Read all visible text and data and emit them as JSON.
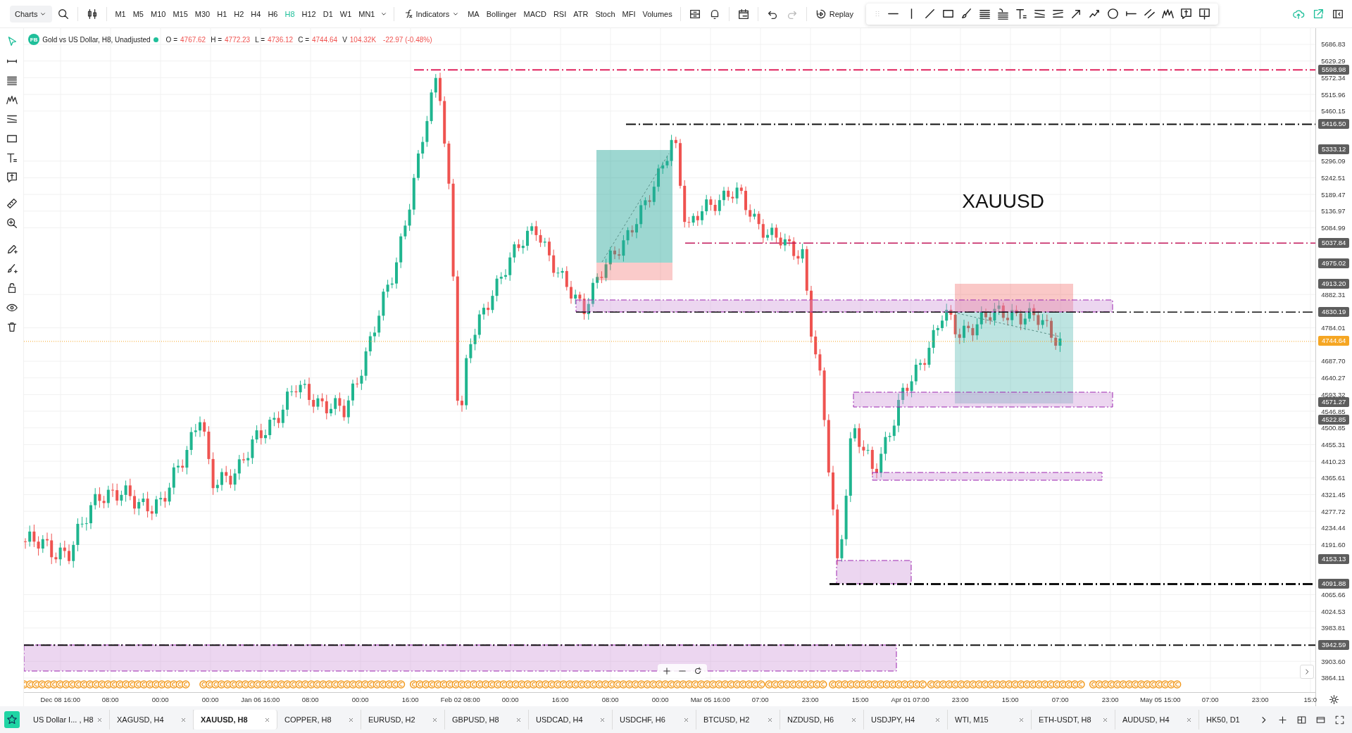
{
  "toolbar": {
    "charts_menu": "Charts",
    "timeframes": [
      {
        "label": "M1",
        "selected": false
      },
      {
        "label": "M5",
        "selected": false
      },
      {
        "label": "M10",
        "selected": false
      },
      {
        "label": "M15",
        "selected": false
      },
      {
        "label": "M30",
        "selected": false
      },
      {
        "label": "H1",
        "selected": false
      },
      {
        "label": "H2",
        "selected": false
      },
      {
        "label": "H4",
        "selected": false
      },
      {
        "label": "H6",
        "selected": false
      },
      {
        "label": "H8",
        "selected": true
      },
      {
        "label": "H12",
        "selected": false
      },
      {
        "label": "D1",
        "selected": false
      },
      {
        "label": "W1",
        "selected": false
      },
      {
        "label": "MN1",
        "selected": false
      }
    ],
    "indicators_button": "Indicators",
    "indicators": [
      "MA",
      "Bollinger",
      "MACD",
      "RSI",
      "ATR",
      "Stoch",
      "MFI",
      "Volumes"
    ],
    "replay_button": "Replay"
  },
  "legend": {
    "badge": "FB",
    "title": "Gold vs US Dollar, H8, Unadjusted",
    "values": [
      {
        "label": "O =",
        "value": "4767.62"
      },
      {
        "label": "H =",
        "value": "4772.23"
      },
      {
        "label": "L =",
        "value": "4736.12"
      },
      {
        "label": "C =",
        "value": "4744.64"
      },
      {
        "label": "V",
        "value": "104.32K"
      }
    ],
    "change": "-22.97 (-0.48%)"
  },
  "chart": {
    "symbol_label": "XAUUSD",
    "price_ticks": [
      "5686.83",
      "5629.29",
      "5572.34",
      "5515.96",
      "5460.15",
      "5296.09",
      "5242.51",
      "5189.47",
      "5136.97",
      "5084.99",
      "4882.31",
      "4784.01",
      "4687.70",
      "4640.27",
      "4593.32",
      "4546.85",
      "4500.85",
      "4455.31",
      "4410.23",
      "4365.61",
      "4321.45",
      "4277.72",
      "4234.44",
      "4191.60",
      "4065.66",
      "4024.53",
      "3983.81",
      "3903.60",
      "3864.11"
    ],
    "price_tags": [
      {
        "value": "5598.98",
        "color": "#5d5d5d"
      },
      {
        "value": "5416.50",
        "color": "#5d5d5d"
      },
      {
        "value": "5333.12",
        "color": "#5d5d5d"
      },
      {
        "value": "5037.84",
        "color": "#5d5d5d"
      },
      {
        "value": "4975.02",
        "color": "#5d5d5d"
      },
      {
        "value": "4913.20",
        "color": "#5d5d5d"
      },
      {
        "value": "4830.19",
        "color": "#5d5d5d"
      },
      {
        "value": "4744.64",
        "color": "#f5a623"
      },
      {
        "value": "4571.27",
        "color": "#5d5d5d"
      },
      {
        "value": "4522.85",
        "color": "#5d5d5d"
      },
      {
        "value": "4153.13",
        "color": "#5d5d5d"
      },
      {
        "value": "4091.88",
        "color": "#5d5d5d"
      },
      {
        "value": "3942.59",
        "color": "#5d5d5d"
      }
    ],
    "time_labels": [
      "Dec 08 16:00",
      "08:00",
      "00:00",
      "00:00",
      "Jan 06 16:00",
      "08:00",
      "00:00",
      "16:00",
      "Feb 02 08:00",
      "00:00",
      "16:00",
      "08:00",
      "00:00",
      "Mar 05 16:00",
      "07:00",
      "23:00",
      "15:00",
      "Apr 01 07:00",
      "23:00",
      "15:00",
      "07:00",
      "23:00",
      "May 05 15:00",
      "07:00",
      "23:00",
      "15:0"
    ]
  },
  "tabs": [
    {
      "label": "US Dollar I... , H8",
      "selected": false,
      "closable": true
    },
    {
      "label": "XAGUSD, H4",
      "selected": false,
      "closable": true
    },
    {
      "label": "XAUUSD, H8",
      "selected": true,
      "closable": true
    },
    {
      "label": "COPPER, H8",
      "selected": false,
      "closable": true
    },
    {
      "label": "EURUSD, H2",
      "selected": false,
      "closable": true
    },
    {
      "label": "GBPUSD, H8",
      "selected": false,
      "closable": true
    },
    {
      "label": "USDCAD, H4",
      "selected": false,
      "closable": true
    },
    {
      "label": "USDCHF, H6",
      "selected": false,
      "closable": true
    },
    {
      "label": "BTCUSD, H2",
      "selected": false,
      "closable": true
    },
    {
      "label": "NZDUSD, H6",
      "selected": false,
      "closable": true
    },
    {
      "label": "USDJPY, H4",
      "selected": false,
      "closable": true
    },
    {
      "label": "WTI, M15",
      "selected": false,
      "closable": true
    },
    {
      "label": "ETH-USDT, H8",
      "selected": false,
      "closable": true
    },
    {
      "label": "AUDUSD, H4",
      "selected": false,
      "closable": true
    },
    {
      "label": "HK50, D1",
      "selected": false,
      "closable": false
    }
  ]
}
